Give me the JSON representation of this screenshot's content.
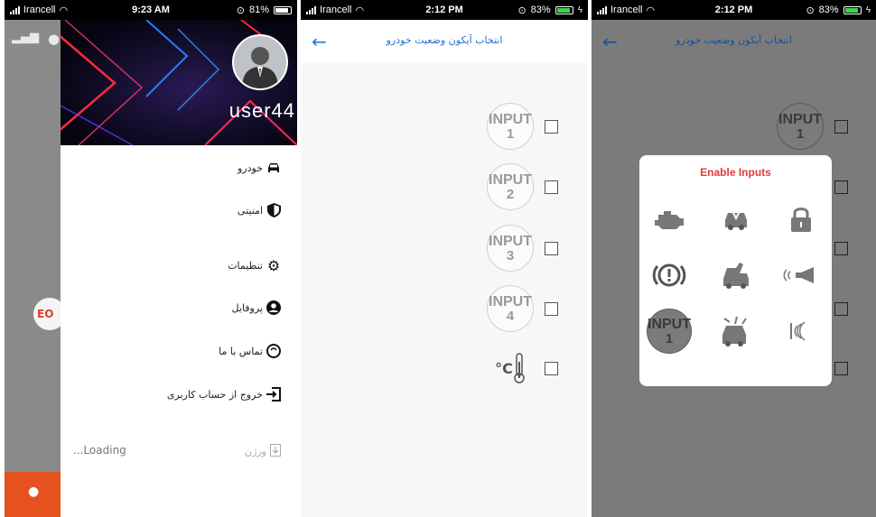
{
  "panel1": {
    "status": {
      "carrier": "Irancell",
      "time": "9:23 AM",
      "battery": "81%"
    },
    "drawer": {
      "username": "user44",
      "menu": [
        {
          "label": "خودرو",
          "icon": "car-icon"
        },
        {
          "label": "امنیتی",
          "icon": "shield-icon"
        },
        {
          "label": "تنظیمات",
          "icon": "gear-icon"
        },
        {
          "label": "پروفایل",
          "icon": "profile-icon"
        },
        {
          "label": "تماس با ما",
          "icon": "contact-icon"
        },
        {
          "label": "خروج از حساب کاربری",
          "icon": "logout-icon"
        }
      ],
      "loading": "...Loading",
      "version_label": "ورژن"
    },
    "background": {
      "logo_text": "EO"
    }
  },
  "panel2": {
    "status": {
      "carrier": "Irancell",
      "time": "2:12 PM",
      "battery": "83%"
    },
    "title": "انتخاب آیکون وضعیت خودرو",
    "input_word": "INPUT",
    "items": [
      {
        "number": "1"
      },
      {
        "number": "2"
      },
      {
        "number": "3"
      },
      {
        "number": "4"
      }
    ],
    "temp_symbol": "°C"
  },
  "panel3": {
    "status": {
      "carrier": "Irancell",
      "time": "2:12 PM",
      "battery": "83%"
    },
    "title": "انتخاب آیکون وضعیت خودرو",
    "dialog_title": "Enable Inputs",
    "dialog_input_number": "1"
  },
  "colors": {
    "accent_blue": "#2a7ad8",
    "dialog_title": "#e03b3b",
    "battery_green": "#3dd64a"
  }
}
